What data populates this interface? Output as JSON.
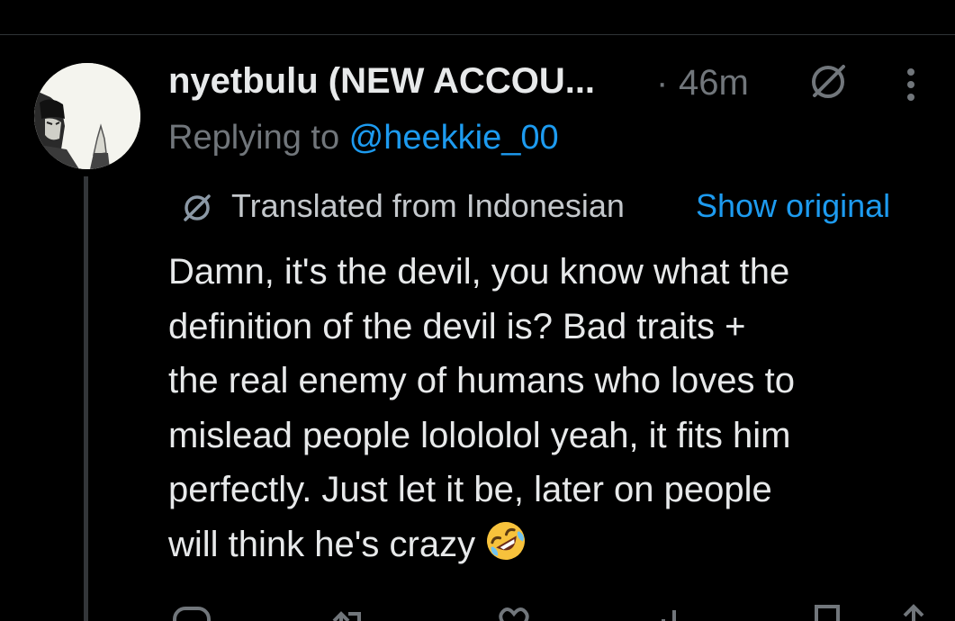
{
  "post": {
    "display_name": "nyetbulu (NEW ACCOU...",
    "separator": "·",
    "time": "46m",
    "replying_label": "Replying to ",
    "replying_handle": "@heekkie_00",
    "translated_label": "Translated from Indonesian",
    "show_original_label": "Show original",
    "body_lines": [
      "Damn, it's the devil, you know what the",
      "definition of the devil is? Bad traits +",
      "the real enemy of humans who loves to",
      "mislead people lolololol yeah, it fits him",
      "perfectly. Just let it be, later on people",
      "will think he's crazy"
    ],
    "body_emoji": "rolling-on-floor-laughing-emoji"
  },
  "icons": {
    "grok": "grok-icon",
    "more": "more-vertical-icon",
    "translate": "translate-icon",
    "reply": "reply-icon",
    "repost": "repost-icon",
    "like": "like-icon",
    "views": "views-icon",
    "bookmark": "bookmark-icon",
    "share": "share-icon"
  },
  "colors": {
    "background": "#000000",
    "text": "#e7e9ea",
    "muted": "#71767b",
    "accent": "#1d9bf0",
    "divider": "#2f3336"
  }
}
